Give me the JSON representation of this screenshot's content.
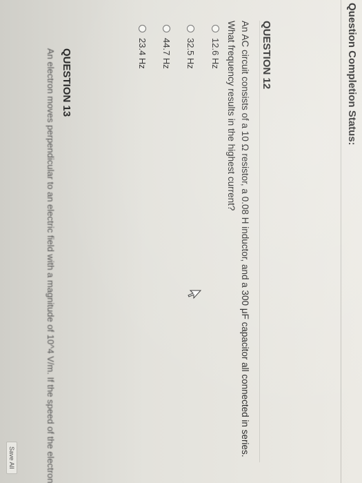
{
  "header": {
    "status_label": "Question Completion Status:"
  },
  "question12": {
    "title": "QUESTION 12",
    "text": "An AC circuit consists of a 10 Ω resistor, a 0.08 H inductor, and a 300 μF capacitor all connected in series. What frequency results in the highest current?",
    "options": [
      {
        "label": "12.6 Hz",
        "selected": false
      },
      {
        "label": "32.5 Hz",
        "selected": false
      },
      {
        "label": "44.7 Hz",
        "selected": false
      },
      {
        "label": "23.4 Hz",
        "selected": false
      }
    ]
  },
  "question13": {
    "title": "QUESTION 13",
    "text": "An electron moves perpendicular to an electric field with a magnitude of 10^4 V/m. If the speed of the electron is"
  },
  "actions": {
    "save_label": "Save All"
  }
}
